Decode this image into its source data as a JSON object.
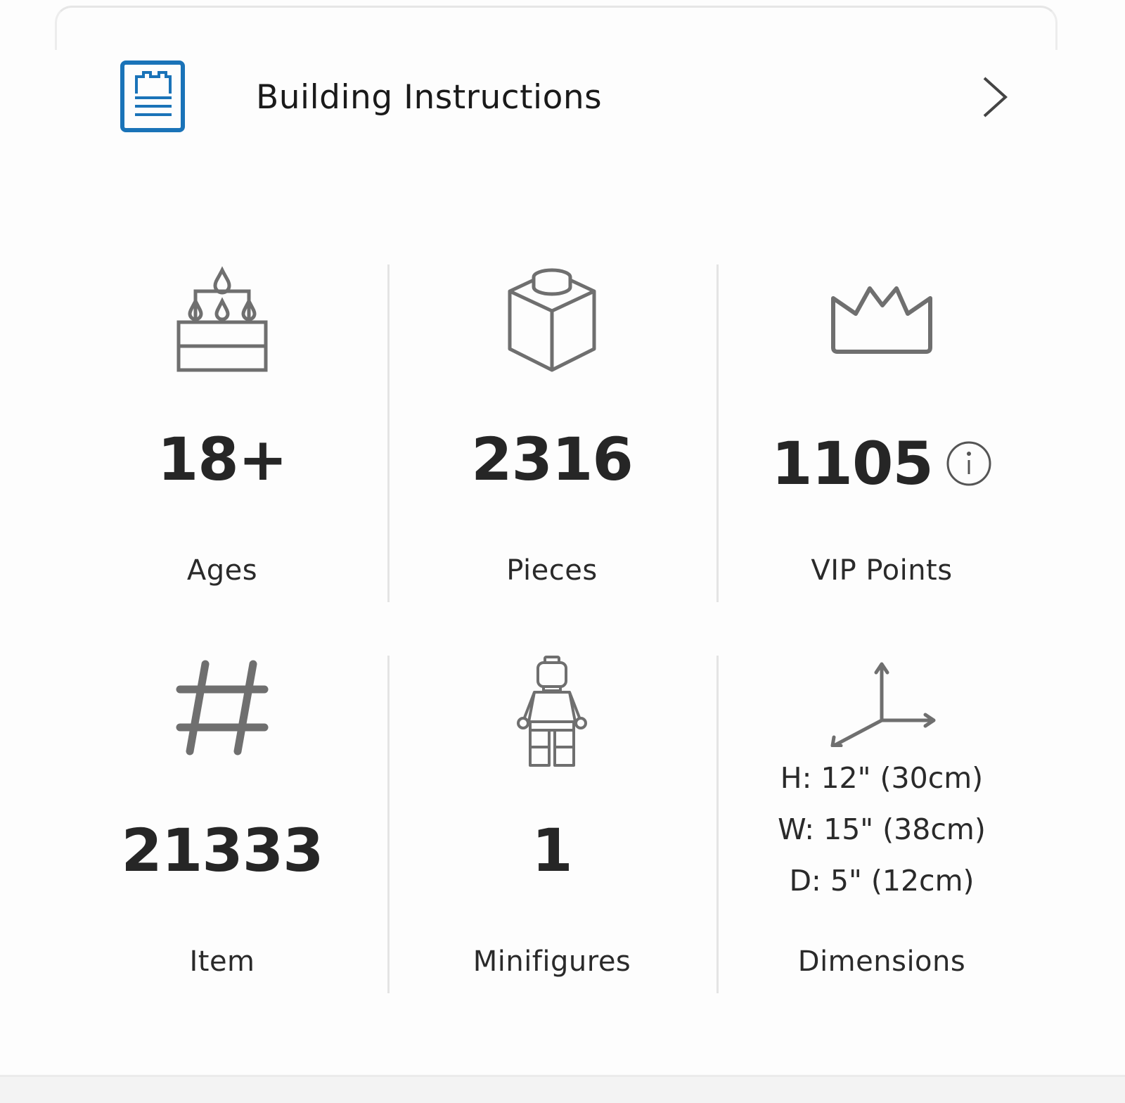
{
  "instructions": {
    "label": "Building Instructions",
    "icon": "instructions-book-icon",
    "accent_color": "#1a73b8"
  },
  "specs": [
    {
      "id": "ages",
      "icon": "birthday-cake-icon",
      "value": "18+",
      "label": "Ages"
    },
    {
      "id": "pieces",
      "icon": "lego-brick-icon",
      "value": "2316",
      "label": "Pieces"
    },
    {
      "id": "vip",
      "icon": "crown-icon",
      "value": "1105",
      "label": "VIP Points",
      "has_info": true
    },
    {
      "id": "item",
      "icon": "hash-icon",
      "value": "21333",
      "label": "Item"
    },
    {
      "id": "minifigures",
      "icon": "minifigure-icon",
      "value": "1",
      "label": "Minifigures"
    },
    {
      "id": "dimensions",
      "icon": "dimensions-axes-icon",
      "label": "Dimensions",
      "lines": [
        "H: 12\" (30cm)",
        "W: 15\" (38cm)",
        "D: 5\" (12cm)"
      ]
    }
  ],
  "colors": {
    "icon_gray": "#6f6f6f",
    "text": "#262626",
    "divider": "#e4e4e4"
  }
}
